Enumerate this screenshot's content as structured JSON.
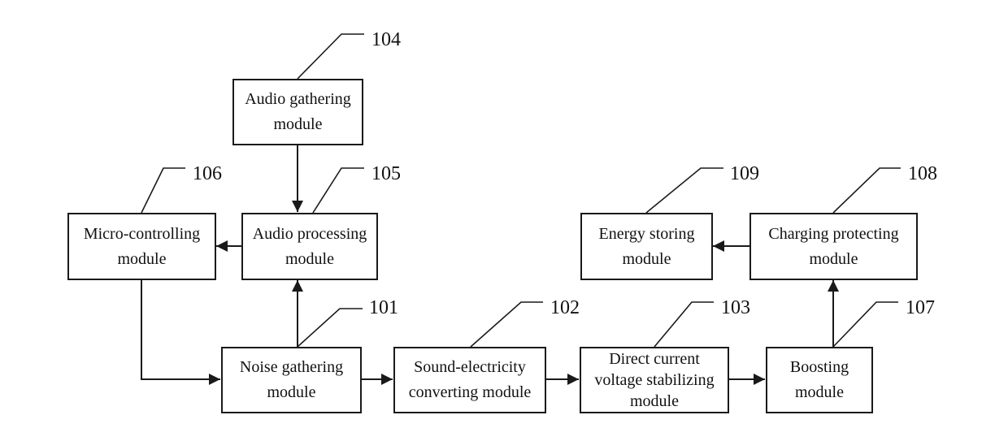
{
  "diagram": {
    "modules": [
      {
        "id": "101",
        "name": "noise-gathering",
        "lines": [
          "Noise gathering",
          "module"
        ]
      },
      {
        "id": "102",
        "name": "sound-electricity-converting",
        "lines": [
          "Sound-electricity",
          "converting module"
        ]
      },
      {
        "id": "103",
        "name": "dc-voltage-stabilizing",
        "lines": [
          "Direct current",
          "voltage stabilizing",
          "module"
        ]
      },
      {
        "id": "104",
        "name": "audio-gathering",
        "lines": [
          "Audio gathering",
          "module"
        ]
      },
      {
        "id": "105",
        "name": "audio-processing",
        "lines": [
          "Audio processing",
          "module"
        ]
      },
      {
        "id": "106",
        "name": "micro-controlling",
        "lines": [
          "Micro-controlling",
          "module"
        ]
      },
      {
        "id": "107",
        "name": "boosting",
        "lines": [
          "Boosting",
          "module"
        ]
      },
      {
        "id": "108",
        "name": "charging-protecting",
        "lines": [
          "Charging protecting",
          "module"
        ]
      },
      {
        "id": "109",
        "name": "energy-storing",
        "lines": [
          "Energy storing",
          "module"
        ]
      }
    ],
    "connections": [
      {
        "from": "104",
        "to": "105"
      },
      {
        "from": "105",
        "to": "106"
      },
      {
        "from": "101",
        "to": "105"
      },
      {
        "from": "106",
        "to": "101"
      },
      {
        "from": "101",
        "to": "102"
      },
      {
        "from": "102",
        "to": "103"
      },
      {
        "from": "103",
        "to": "107"
      },
      {
        "from": "107",
        "to": "108"
      },
      {
        "from": "108",
        "to": "109"
      }
    ]
  }
}
